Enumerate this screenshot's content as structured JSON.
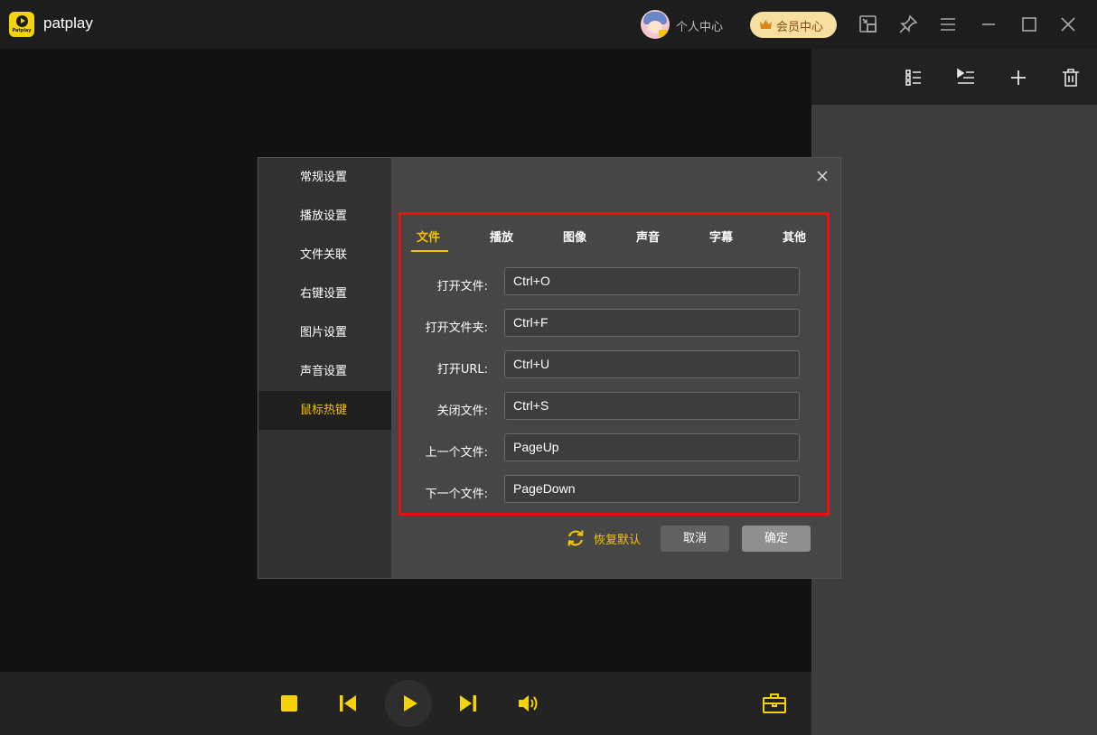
{
  "app": {
    "title": "patplay",
    "logo_text": "Patplay"
  },
  "titlebar": {
    "user_center": "个人中心",
    "vip_center": "会员中心",
    "icons": [
      "mini-player-icon",
      "pin-icon",
      "menu-icon",
      "minimize-icon",
      "maximize-icon",
      "close-icon"
    ]
  },
  "playlist": {
    "icons": [
      "list-view-icon",
      "playlist-play-icon",
      "add-icon",
      "delete-icon"
    ]
  },
  "controls": {
    "icons": [
      "stop-icon",
      "previous-icon",
      "play-icon",
      "next-icon",
      "volume-icon",
      "toolbox-icon"
    ]
  },
  "colors": {
    "accent": "#f5c400",
    "highlight_border": "#e81010",
    "vip_bg": "#f7dfa0"
  },
  "settings": {
    "sidebar": [
      {
        "label": "常规设置"
      },
      {
        "label": "播放设置"
      },
      {
        "label": "文件关联"
      },
      {
        "label": "右键设置"
      },
      {
        "label": "图片设置"
      },
      {
        "label": "声音设置"
      },
      {
        "label": "鼠标热键",
        "active": true
      }
    ],
    "tabs": [
      {
        "label": "文件",
        "active": true
      },
      {
        "label": "播放"
      },
      {
        "label": "图像"
      },
      {
        "label": "声音"
      },
      {
        "label": "字幕"
      },
      {
        "label": "其他"
      }
    ],
    "hotkeys": [
      {
        "label": "打开文件:",
        "value": "Ctrl+O"
      },
      {
        "label": "打开文件夹:",
        "value": "Ctrl+F"
      },
      {
        "label": "打开URL:",
        "value": "Ctrl+U"
      },
      {
        "label": "关闭文件:",
        "value": "Ctrl+S"
      },
      {
        "label": "上一个文件:",
        "value": "PageUp"
      },
      {
        "label": "下一个文件:",
        "value": "PageDown"
      }
    ],
    "restore_label": "恢复默认",
    "cancel_label": "取消",
    "ok_label": "确定"
  }
}
